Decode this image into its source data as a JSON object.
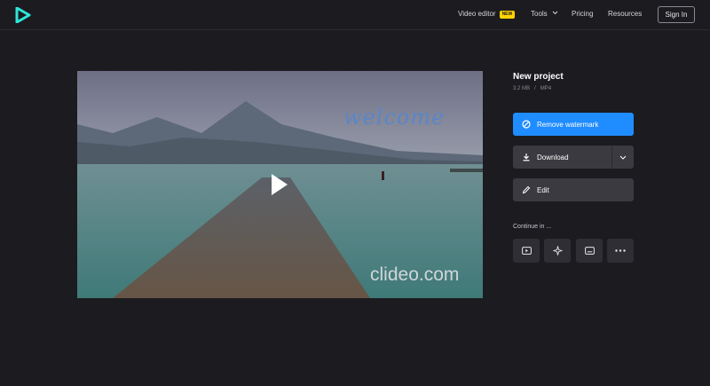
{
  "header": {
    "logo": "clideo-play-logo",
    "nav": {
      "video_editor": "Video editor",
      "video_editor_badge": "NEW",
      "tools": "Tools",
      "pricing": "Pricing",
      "resources": "Resources"
    },
    "sign_in": "Sign In"
  },
  "video": {
    "overlay_text": "welcome",
    "watermark": "clideo.com"
  },
  "project": {
    "title": "New project",
    "size": "3.2 MB",
    "separator": "/",
    "format": "MP4"
  },
  "actions": {
    "remove_watermark": "Remove watermark",
    "download": "Download",
    "edit": "Edit"
  },
  "continue": {
    "label": "Continue in ...",
    "tools": [
      "video-icon",
      "sparkle-icon",
      "subtitles-icon",
      "more-icon"
    ]
  },
  "colors": {
    "background": "#1b1b20",
    "accent": "#1f8cff",
    "badge": "#ffd400",
    "logo": "#2ee6d6"
  }
}
